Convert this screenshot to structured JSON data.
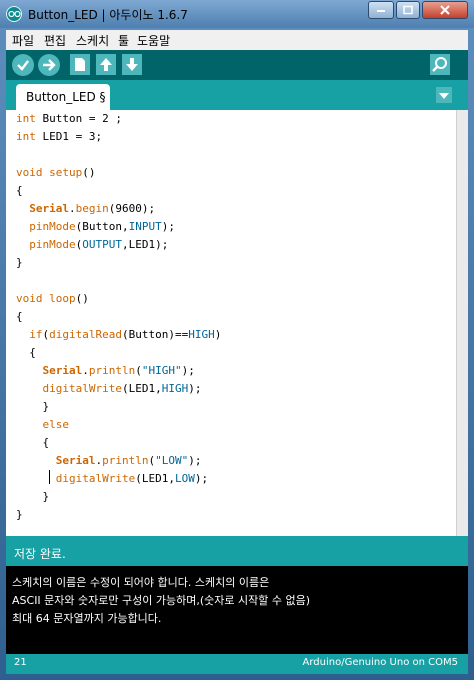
{
  "window": {
    "title": "Button_LED | 아두이노 1.6.7"
  },
  "menu": [
    "파일",
    "편집",
    "스케치",
    "툴",
    "도움말"
  ],
  "toolbar": {
    "buttons": [
      "verify-icon",
      "upload-icon",
      "new-icon",
      "open-icon",
      "save-icon",
      "serial-monitor-icon"
    ]
  },
  "tab": {
    "label": "Button_LED §"
  },
  "code": [
    "int Button = 2 ;",
    "int LED1 = 3;",
    "",
    "void setup()",
    "{",
    "  Serial.begin(9600);",
    "  pinMode(Button,INPUT);",
    "  pinMode(OUTPUT,LED1);",
    "}",
    "",
    "void loop()",
    "{",
    "  if(digitalRead(Button)==HIGH)",
    "  {",
    "    Serial.println(\"HIGH\");",
    "    digitalWrite(LED1,HIGH);",
    "    }",
    "    else",
    "    {",
    "      Serial.println(\"LOW\");",
    "      digitalWrite(LED1,LOW);",
    "    }",
    "}"
  ],
  "status": {
    "message": "저장 완료."
  },
  "console": [
    "스케치의 이름은 수정이 되어야 합니다. 스케치의 이름은",
    "ASCII 문자와 숫자로만 구성이 가능하며,(숫자로 시작할 수 없음)",
    "최대 64 문자열까지 가능합니다."
  ],
  "footer": {
    "line": "21",
    "board": "Arduino/Genuino Uno on COM5"
  },
  "colors": {
    "teal_dark": "#006468",
    "teal": "#17a1a5",
    "button": "#4db7bb",
    "keyword": "#cc6600",
    "constant": "#006699"
  }
}
